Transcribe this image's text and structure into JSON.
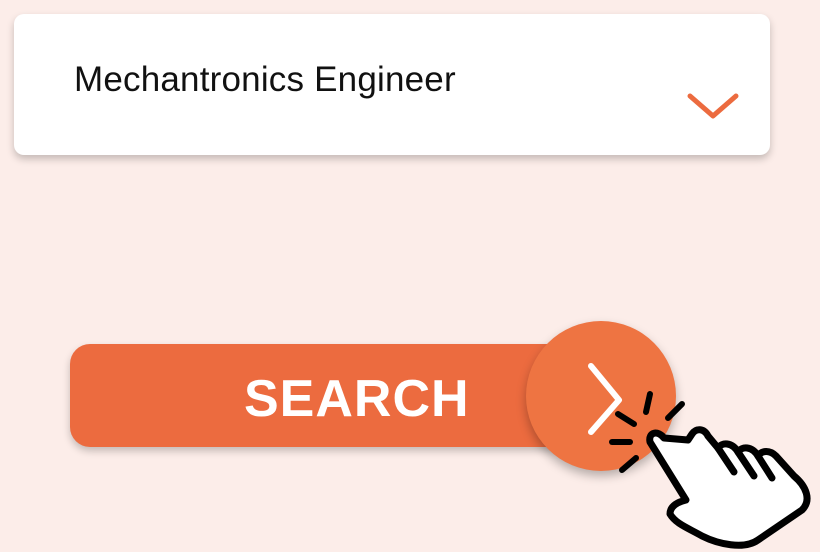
{
  "dropdown": {
    "selected_value": "Mechantronics Engineer",
    "chevron_icon": "chevron-down-icon",
    "chevron_color": "#ec6b3f"
  },
  "search": {
    "label": "SEARCH",
    "arrow_icon": "chevron-right-icon",
    "button_color": "#ec6b3f",
    "circle_color": "#ee7442"
  },
  "cursor": {
    "icon": "hand-pointer-click-icon"
  },
  "colors": {
    "background": "#fcede9",
    "card": "#ffffff",
    "text": "#111111"
  }
}
